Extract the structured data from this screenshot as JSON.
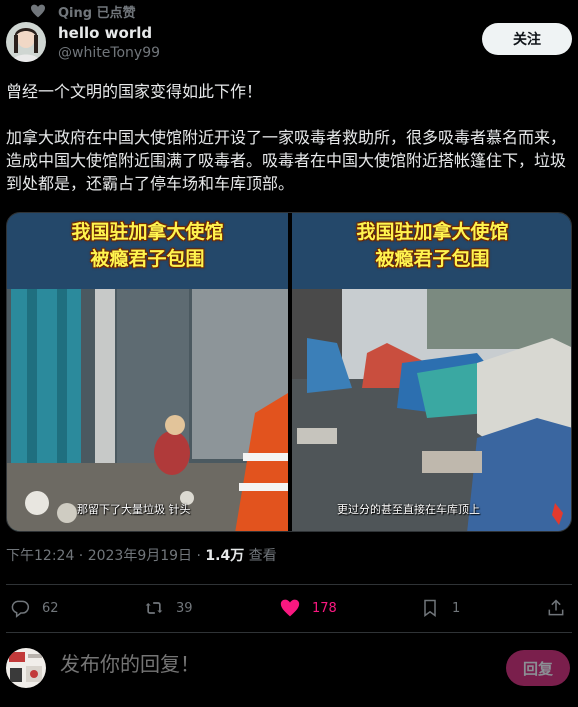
{
  "liked_by": {
    "icon": "heart-icon",
    "text": "Qing 已点赞"
  },
  "author": {
    "display_name": "hello world",
    "handle": "@whiteTony99",
    "follow_label": "关注"
  },
  "tweet": {
    "paragraphs": [
      "曾经一个文明的国家变得如此下作！",
      "加拿大政府在中国大使馆附近开设了一家吸毒者救助所，很多吸毒者慕名而来，造成中国大使馆附近围满了吸毒者。吸毒者在中国大使馆附近搭帐篷住下，垃圾到处都是，还霸占了停车场和车库顶部。"
    ]
  },
  "media": {
    "left": {
      "title_line1": "我国驻加拿大使馆",
      "title_line2": "被瘾君子包围",
      "caption": "那留下了大量垃圾 针头"
    },
    "right": {
      "title_line1": "我国驻加拿大使馆",
      "title_line2": "被瘾君子包围",
      "caption": "更过分的甚至直接在车库顶上"
    }
  },
  "meta": {
    "timestamp": "下午12:24 · 2023年9月19日 · ",
    "views_count": "1.4万",
    "views_label": " 查看"
  },
  "actions": {
    "replies": "62",
    "retweets": "39",
    "likes": "178",
    "bookmarks": "1"
  },
  "reply": {
    "placeholder": "发布你的回复！",
    "button_label": "回复"
  },
  "colors": {
    "like_active": "#f91880",
    "title_yellow": "#fff44f"
  }
}
